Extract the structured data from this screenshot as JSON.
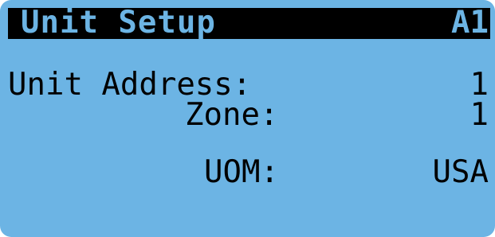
{
  "header": {
    "title": "Unit Setup",
    "code": "A1"
  },
  "fields": {
    "unit_address": {
      "label": "Unit Address:",
      "value": "1"
    },
    "zone": {
      "label": "Zone:",
      "value": "1"
    },
    "uom": {
      "label": "UOM:",
      "value": "USA"
    }
  },
  "colors": {
    "screen_background": "#6cb4e4",
    "title_bar": "#000000",
    "text": "#000000"
  }
}
